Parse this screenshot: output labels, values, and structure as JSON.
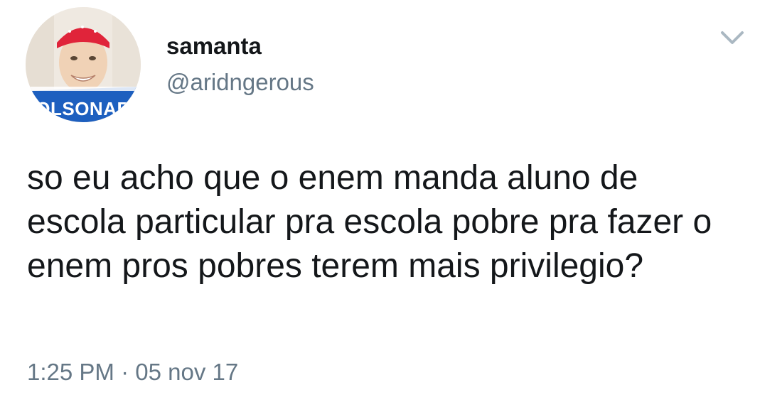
{
  "author": {
    "display_name": "samanta",
    "handle": "@aridngerous",
    "avatar_banner_text": "OLSONAR"
  },
  "tweet": {
    "text": "so eu acho que o enem manda aluno de escola particular pra escola pobre pra fazer o enem pros pobres terem mais privilegio?",
    "time": "1:25 PM",
    "separator": " · ",
    "date": "05 nov 17"
  },
  "icons": {
    "menu": "chevron-down-icon"
  },
  "colors": {
    "text": "#14171a",
    "secondary": "#657786",
    "banner": "#1d5fbf",
    "bandana": "#e0243a"
  }
}
